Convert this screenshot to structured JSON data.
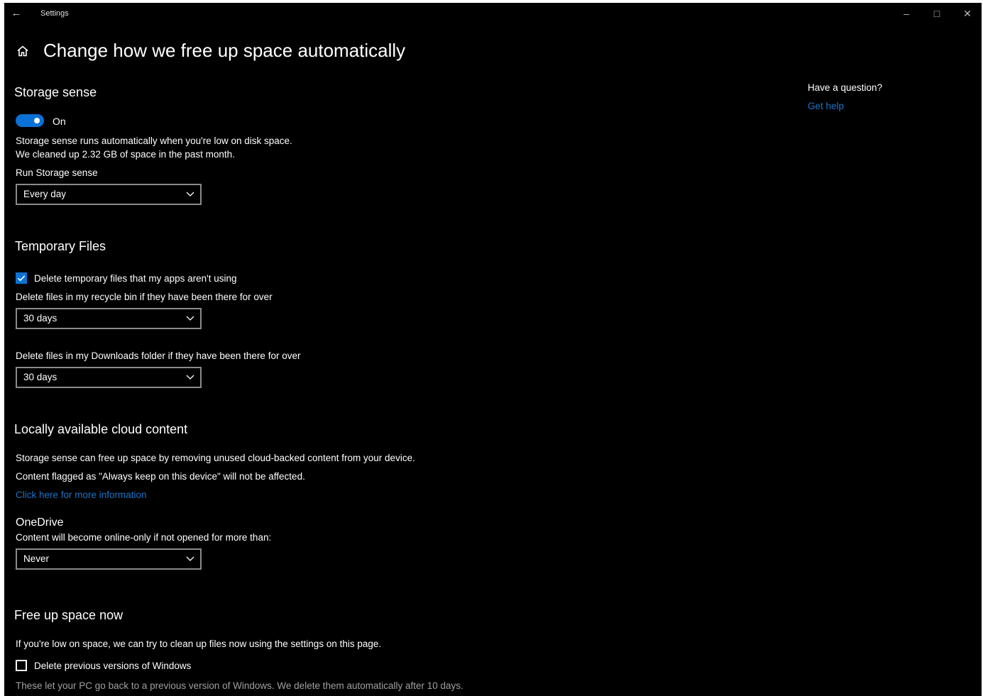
{
  "window": {
    "title": "Settings"
  },
  "icons": {
    "back": "back-arrow-icon",
    "minimize": "minimize-icon",
    "maximize": "maximize-icon",
    "close": "close-icon",
    "home": "home-icon",
    "chevron": "chevron-down-icon",
    "checkmark": "checkmark-icon"
  },
  "colors": {
    "accent": "#0a72d6",
    "link": "#1a73c8",
    "background": "#000000"
  },
  "page": {
    "title": "Change how we free up space automatically"
  },
  "storage_sense": {
    "heading": "Storage sense",
    "toggle_state": "On",
    "desc_1": "Storage sense runs automatically when you're low on disk space.",
    "desc_2": "We cleaned up 2.32 GB of space in the past month.",
    "run_label": "Run Storage sense",
    "run_value": "Every day"
  },
  "temporary_files": {
    "heading": "Temporary Files",
    "delete_temp_label": "Delete temporary files that my apps aren't using",
    "delete_temp_checked": true,
    "recycle_label": "Delete files in my recycle bin if they have been there for over",
    "recycle_value": "30 days",
    "downloads_label": "Delete files in my Downloads folder if they have been there for over",
    "downloads_value": "30 days"
  },
  "cloud": {
    "heading": "Locally available cloud content",
    "desc_1": "Storage sense can free up space by removing unused cloud-backed content from your device.",
    "desc_2": "Content flagged as \"Always keep on this device\" will not be affected.",
    "more_info_link": "Click here for more information",
    "onedrive_heading": "OneDrive",
    "onedrive_label": "Content will become online-only if not opened for more than:",
    "onedrive_value": "Never"
  },
  "free_up": {
    "heading": "Free up space now",
    "desc": "If you're low on space, we can try to clean up files now using the settings on this page.",
    "prev_windows_label": "Delete previous versions of Windows",
    "prev_windows_checked": false,
    "prev_windows_note": "These let your PC go back to a previous version of Windows. We delete them automatically after 10 days."
  },
  "help": {
    "question": "Have a question?",
    "link": "Get help"
  }
}
